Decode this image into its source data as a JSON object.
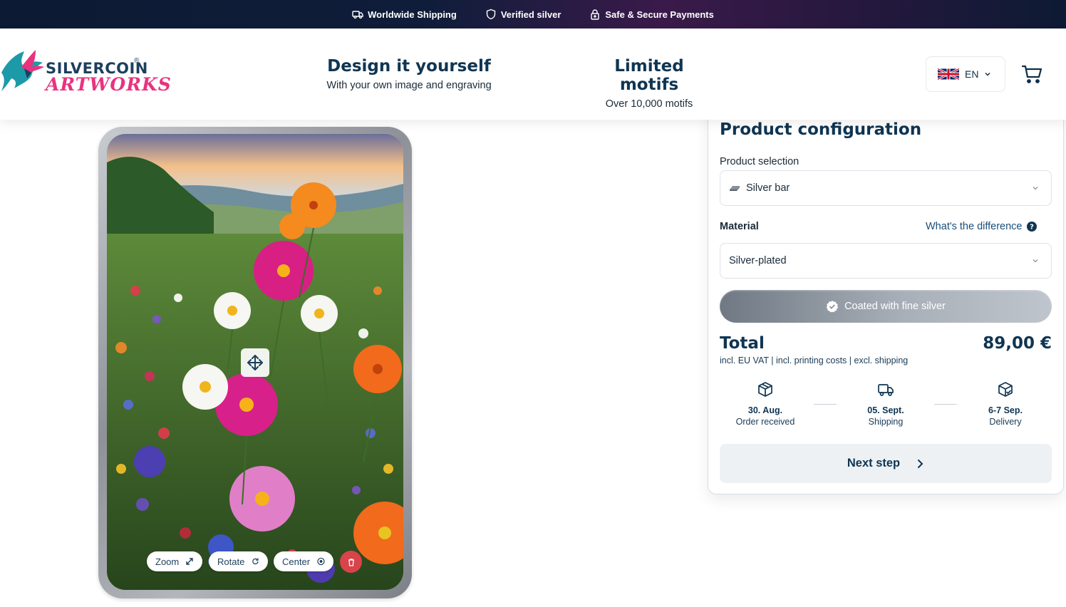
{
  "topbar": {
    "items": [
      {
        "icon": "truck-icon",
        "label": "Worldwide Shipping"
      },
      {
        "icon": "shield-icon",
        "label": "Verified silver"
      },
      {
        "icon": "lock-icon",
        "label": "Safe & Secure Payments"
      }
    ]
  },
  "header": {
    "logo": {
      "line1": "SILVERCOIN",
      "reg": "®",
      "line2": "ARTWORKS"
    },
    "promos": [
      {
        "title": "Design it yourself",
        "subtitle": "With your own image and engraving"
      },
      {
        "title": "Limited motifs",
        "subtitle": "Over 10,000 motifs"
      }
    ],
    "language": {
      "code": "EN",
      "flag": "uk-flag-icon"
    },
    "cart_icon": "cart-icon"
  },
  "preview": {
    "image_icon": "flower-field-image",
    "tools": {
      "zoom": "Zoom",
      "rotate": "Rotate",
      "center": "Center"
    }
  },
  "config": {
    "title": "Product configuration",
    "product_label": "Product selection",
    "product_value": "Silver bar",
    "material_label": "Material",
    "difference_link": "What's the difference",
    "material_value": "Silver-plated",
    "coated_label": "Coated with fine silver",
    "total_label": "Total",
    "total_price": "89,00 €",
    "total_note": "incl. EU VAT | incl. printing costs | excl. shipping",
    "steps": [
      {
        "icon": "box-icon",
        "date": "30. Aug.",
        "desc": "Order received"
      },
      {
        "icon": "truck-icon",
        "date": "05. Sept.",
        "desc": "Shipping"
      },
      {
        "icon": "package-check-icon",
        "date": "6-7 Sep.",
        "desc": "Delivery"
      }
    ],
    "next_label": "Next step"
  },
  "colors": {
    "primary": "#0f3552",
    "accent_pink": "#e8337f",
    "delete_red": "#d9434a",
    "teal_bird": "#1d9aa8"
  }
}
